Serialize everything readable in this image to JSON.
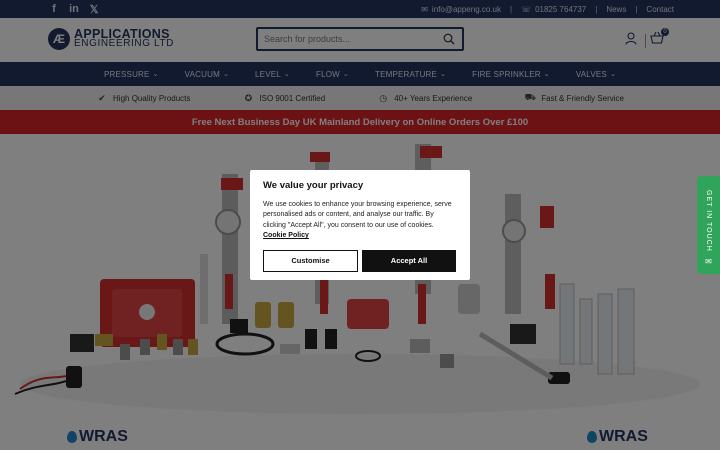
{
  "topbar": {
    "social": [
      {
        "icon": "facebook-icon",
        "glyph": "f"
      },
      {
        "icon": "linkedin-icon",
        "glyph": "in"
      },
      {
        "icon": "x-icon",
        "glyph": "𝕏"
      }
    ],
    "email": "info@appeng.co.uk",
    "phone": "01825 764737",
    "news": "News",
    "contact": "Contact"
  },
  "header": {
    "logo_line1": "APPLICATIONS",
    "logo_line2": "ENGINEERING LTD",
    "search_placeholder": "Search for products...",
    "cart_count": "0"
  },
  "nav": {
    "items": [
      "PRESSURE",
      "VACUUM",
      "LEVEL",
      "FLOW",
      "TEMPERATURE",
      "FIRE SPRINKLER",
      "VALVES"
    ]
  },
  "features": [
    {
      "icon": "badge-check-icon",
      "label": "High Quality Products"
    },
    {
      "icon": "award-icon",
      "label": "ISO 9001 Certified"
    },
    {
      "icon": "clock-icon",
      "label": "40+ Years Experience"
    },
    {
      "icon": "truck-icon",
      "label": "Fast & Friendly Service"
    }
  ],
  "promo": "Free Next Business Day UK Mainland Delivery on Online Orders Over £100",
  "wras": "WRAS",
  "side_tab": "GET IN TOUCH",
  "cookie": {
    "title": "We value your privacy",
    "body": "We use cookies to enhance your browsing experience, serve personalised ads or content, and analyse our traffic. By clicking \"Accept All\", you consent to our use of cookies.",
    "policy_link": "Cookie Policy",
    "customise": "Customise",
    "accept": "Accept All"
  },
  "colors": {
    "navy": "#243461",
    "red": "#d8242b",
    "green": "#2fa45a"
  }
}
